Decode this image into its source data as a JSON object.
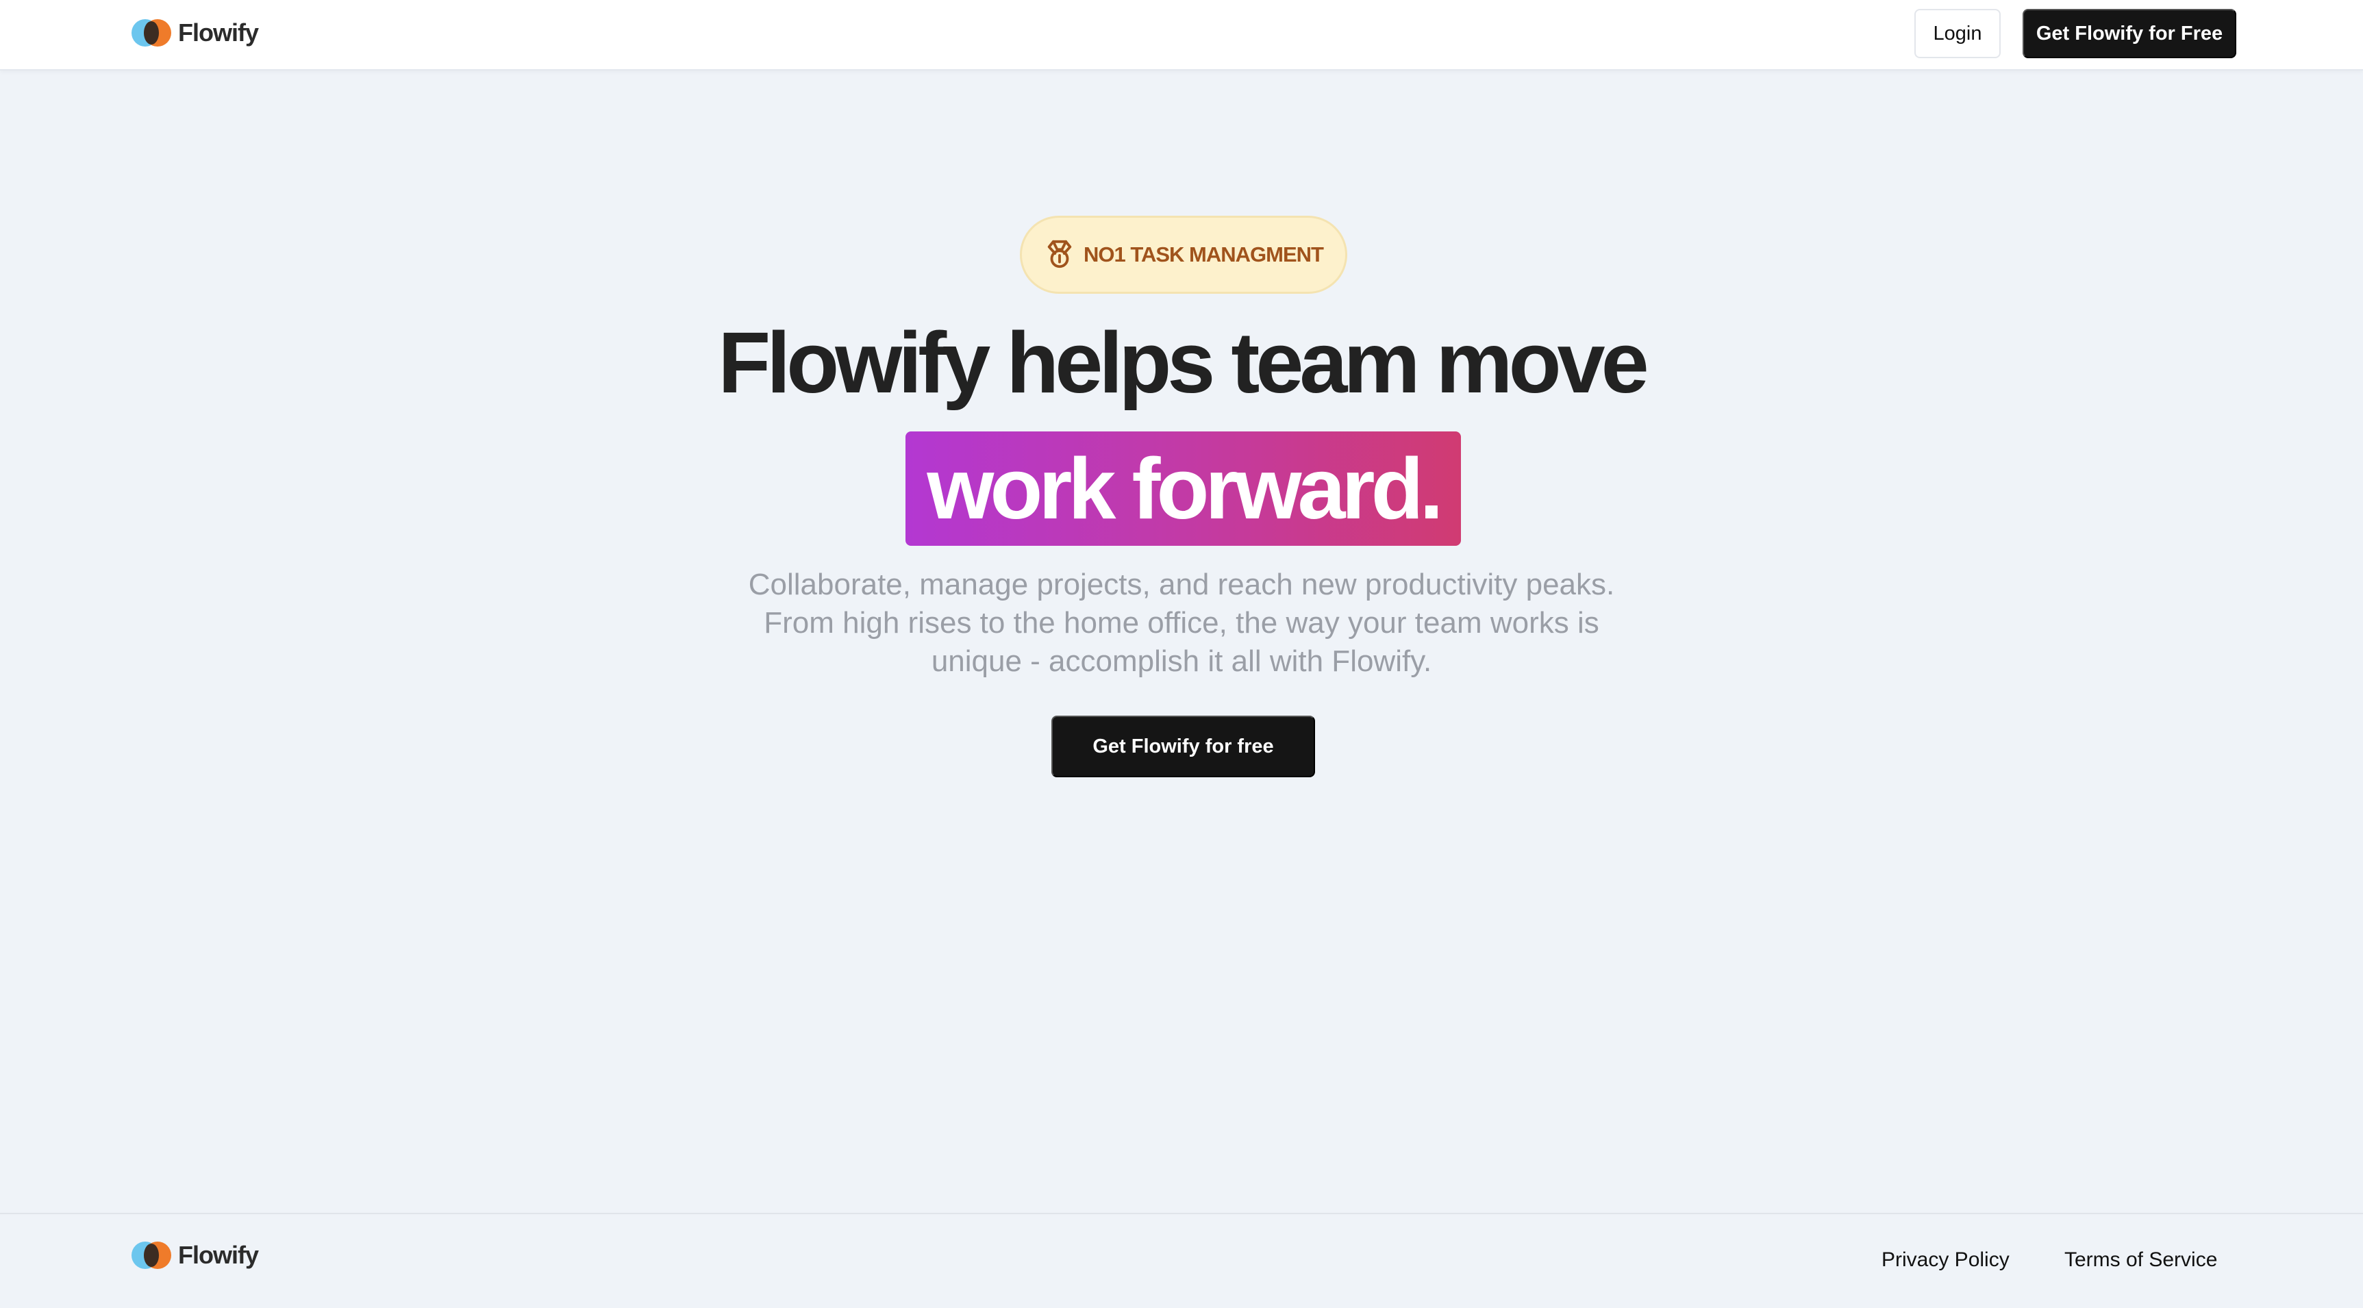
{
  "brand": {
    "name": "Flowify"
  },
  "header": {
    "login_label": "Login",
    "cta_label": "Get Flowify for Free"
  },
  "hero": {
    "badge_icon": "medal-icon",
    "badge_text": "NO1 TASK MANAGMENT",
    "headline": "Flowify helps team move",
    "highlight": "work forward.",
    "subtext": [
      "Collaborate, manage projects, and reach new productivity peaks.",
      "From high rises to the home office, the way your team works is",
      "unique - accomplish it all with Flowify."
    ],
    "cta_label": "Get Flowify for free"
  },
  "footer": {
    "privacy_label": "Privacy Policy",
    "terms_label": "Terms of Service"
  },
  "colors": {
    "background": "#eff3f8",
    "primary_button": "#151515",
    "badge_bg": "#fdf1cc",
    "badge_text": "#a0531c",
    "highlight_start": "#b338d2",
    "highlight_end": "#d03b72",
    "logo_blue": "#6cc6ee",
    "logo_orange": "#ef7b2a"
  }
}
